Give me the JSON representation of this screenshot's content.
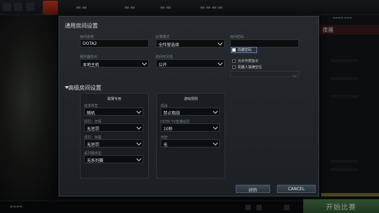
{
  "dialog": {
    "title": "通用房间设置",
    "fields": {
      "room_name_label": "房间名称",
      "room_name_value": "DOTA2",
      "game_mode_label": "比赛模式",
      "game_mode_value": "全阵营选择",
      "password_label": "房间密码",
      "password_value": "",
      "server_label": "服务器地点",
      "server_value": "本地主机",
      "visibility_label": "房间可见性",
      "visibility_value": "公开",
      "hide_password_label": "隐藏密码",
      "hide_password_checked": true,
      "allow_cheats_label": "允许作弊指令",
      "allow_cheats_checked": false,
      "bot_fill_label": "机器人填满空位",
      "bot_fill_checked": false
    },
    "advanced": {
      "title": "高级房间设置",
      "league_panel": {
        "title": "联赛专用",
        "items": [
          {
            "label": "首发阵营",
            "value": "随机"
          },
          {
            "label": "惩罚：天辉",
            "value": "无惩罚"
          },
          {
            "label": "惩罚：夜魇",
            "value": "无惩罚"
          },
          {
            "label": "系列赛类型",
            "value": "无系列赛"
          }
        ]
      },
      "rules_panel": {
        "title": "游戏规则",
        "items": [
          {
            "label": "观战",
            "value": "禁止观战"
          },
          {
            "label": "DOTA TV直播延迟",
            "value": "10秒"
          },
          {
            "label": "作弊",
            "value": "无"
          }
        ]
      }
    },
    "ok_label": "好的",
    "cancel_label": "CANCEL"
  },
  "background": {
    "right_title": "夜魇",
    "play_label": "开始比赛"
  },
  "colors": {
    "dialog_bg": "#22262b",
    "accent_green": "#4d7a47",
    "dire_red": "#3a1b1e"
  }
}
